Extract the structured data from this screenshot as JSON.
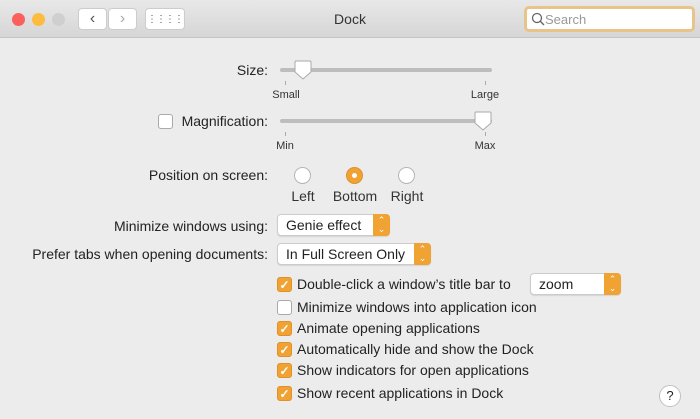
{
  "window": {
    "title": "Dock",
    "search_placeholder": "Search"
  },
  "size": {
    "label": "Size:",
    "min_label": "Small",
    "max_label": "Large",
    "value_percent": 7
  },
  "magnification": {
    "label": "Magnification:",
    "checked": false,
    "min_label": "Min",
    "max_label": "Max",
    "value_percent": 100
  },
  "position": {
    "label": "Position on screen:",
    "options": [
      "Left",
      "Bottom",
      "Right"
    ],
    "selected": "Bottom"
  },
  "minimize": {
    "label": "Minimize windows using:",
    "value": "Genie effect"
  },
  "prefer_tabs": {
    "label": "Prefer tabs when opening documents:",
    "value": "In Full Screen Only"
  },
  "double_click": {
    "label": "Double-click a window’s title bar to",
    "checked": true,
    "value": "zoom"
  },
  "checkboxes": [
    {
      "label": "Minimize windows into application icon",
      "checked": false
    },
    {
      "label": "Animate opening applications",
      "checked": true
    },
    {
      "label": "Automatically hide and show the Dock",
      "checked": true
    },
    {
      "label": "Show indicators for open applications",
      "checked": true
    },
    {
      "label": "Show recent applications in Dock",
      "checked": true
    }
  ],
  "help": "?",
  "colors": {
    "accent": "#f0a233"
  }
}
